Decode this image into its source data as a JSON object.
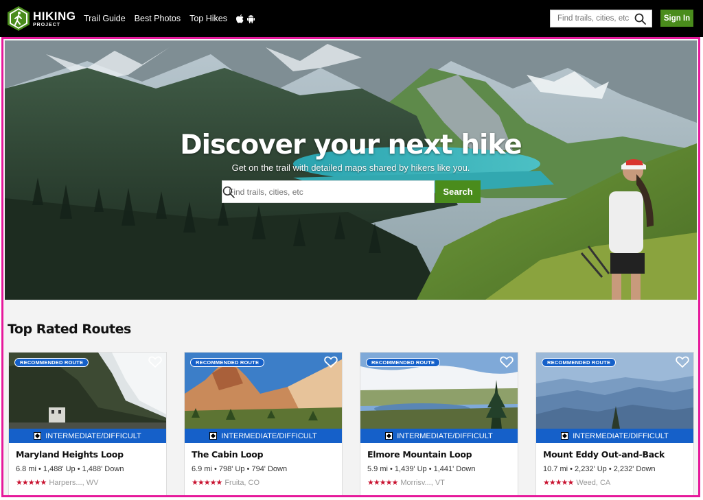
{
  "header": {
    "logo": {
      "line1": "HIKING",
      "line2": "PROJECT"
    },
    "nav": [
      "Trail Guide",
      "Best Photos",
      "Top Hikes"
    ],
    "search_placeholder": "Find trails, cities, etc",
    "signin_label": "Sign In"
  },
  "hero": {
    "title": "Discover your next hike",
    "subtitle": "Get on the trail with detailed maps shared by hikers like you.",
    "search_placeholder": "Find trails, cities, etc",
    "search_button": "Search"
  },
  "section_title": "Top Rated Routes",
  "cards": [
    {
      "badge": "RECOMMENDED ROUTE",
      "difficulty": "INTERMEDIATE/DIFFICULT",
      "name": "Maryland Heights Loop",
      "stats": "6.8 mi • 1,488' Up • 1,488' Down",
      "stars": "★★★★★",
      "location": "Harpers..., WV"
    },
    {
      "badge": "RECOMMENDED ROUTE",
      "difficulty": "INTERMEDIATE/DIFFICULT",
      "name": "The Cabin Loop",
      "stats": "6.9 mi • 798' Up • 794' Down",
      "stars": "★★★★★",
      "location": "Fruita, CO"
    },
    {
      "badge": "RECOMMENDED ROUTE",
      "difficulty": "INTERMEDIATE/DIFFICULT",
      "name": "Elmore Mountain Loop",
      "stats": "5.9 mi • 1,439' Up • 1,441' Down",
      "stars": "★★★★★",
      "location": "Morrisv..., VT"
    },
    {
      "badge": "RECOMMENDED ROUTE",
      "difficulty": "INTERMEDIATE/DIFFICULT",
      "name": "Mount Eddy Out-and-Back",
      "stats": "10.7 mi • 2,232' Up • 2,232' Down",
      "stars": "★★★★★",
      "location": "Weed, CA"
    }
  ],
  "colors": {
    "accent_green": "#4a8c1c",
    "difficulty_blue": "#1560c9",
    "star_red": "#c8102e",
    "highlight_border": "#e6199b"
  }
}
